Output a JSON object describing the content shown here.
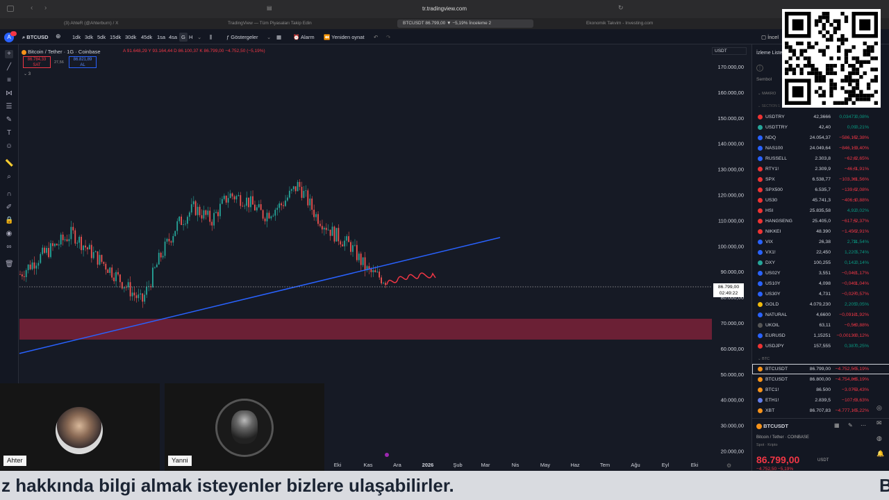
{
  "browser": {
    "url": "tr.tradingview.com"
  },
  "tabs": [
    {
      "label": "(3) AhteR (@Ahterburn) / X"
    },
    {
      "label": "TradingView — Tüm Piyasaları Takip Edin"
    },
    {
      "label": "BTCUSDT 86.799,00 ▼ −5,19% İnceleme 2"
    },
    {
      "label": "Ekonomik Takvim - Investing.com"
    }
  ],
  "toolbar": {
    "symbol": "BTCUSD",
    "intervals": [
      "1dk",
      "3dk",
      "5dk",
      "15dk",
      "30dk",
      "45dk",
      "1sa",
      "4sa",
      "G",
      "H"
    ],
    "indicators": "Göstergeler",
    "alarm": "Alarm",
    "replay": "Yeniden oynat",
    "right_label": "İncel"
  },
  "chart": {
    "title": "Bitcoin / Tether · 1G · Coinbase",
    "ohlc": "A 91.648,29  Y 93.164,44  D 86.100,37  K 86.799,00 −4.752,50 (−5,19%)",
    "sell_price": "86.784,33",
    "sell_label": "SAT",
    "spread": "27,56",
    "buy_price": "86.821,89",
    "buy_label": "AL",
    "indicator_count": "3",
    "currency": "USDT",
    "price_label": "86.799,00",
    "countdown": "02:49:22",
    "y_ticks": [
      "170.000,00",
      "160.000,00",
      "150.000,00",
      "140.000,00",
      "130.000,00",
      "120.000,00",
      "110.000,00",
      "100.000,00",
      "90.000,00",
      "80.000,00",
      "70.000,00",
      "60.000,00",
      "50.000,00",
      "40.000,00",
      "30.000,00",
      "20.000,00"
    ],
    "x_ticks": [
      "Eki",
      "Kas",
      "Ara",
      "2026",
      "Şub",
      "Mar",
      "Nis",
      "May",
      "Haz",
      "Tem",
      "Ağu",
      "Eyl",
      "Eki"
    ]
  },
  "chart_data": {
    "type": "candlestick",
    "title": "Bitcoin / Tether · 1G · Coinbase",
    "y_range": [
      20000,
      170000
    ],
    "x_labels": [
      "Eki",
      "Kas",
      "Ara",
      "2026",
      "Şub",
      "Mar",
      "Nis",
      "May",
      "Haz",
      "Tem",
      "Ağu",
      "Eyl",
      "Eki"
    ],
    "last_close": 86799.0,
    "support_zone": [
      66000,
      75000
    ],
    "trendline": "ascending blue support line",
    "price_path": [
      89000,
      95000,
      100000,
      105000,
      98000,
      92000,
      85000,
      78000,
      95000,
      108000,
      115000,
      110000,
      120000,
      118000,
      112000,
      116000,
      124000,
      112000,
      105000,
      100000,
      90000,
      86799
    ]
  },
  "watchlist": {
    "title": "İzleme Listesi",
    "col_header": "Sembol",
    "group_makro": "MAKRO",
    "section": "SECTION 1",
    "rows": [
      {
        "s": "USDTRY",
        "l": "42,3666",
        "c": "0,03473",
        "p": "0,08%",
        "color": "#e33",
        "pos": true
      },
      {
        "s": "USDTTRY",
        "l": "42,40",
        "c": "0,09",
        "p": "0,21%",
        "color": "#26a69a",
        "pos": true
      },
      {
        "s": "NDQ",
        "l": "24.054,37",
        "c": "−586,15",
        "p": "−2,38%",
        "color": "#2962ff",
        "pos": false
      },
      {
        "s": "NAS100",
        "l": "24.049,64",
        "c": "−846,13",
        "p": "−3,40%",
        "color": "#2962ff",
        "pos": false
      },
      {
        "s": "RUSSELL",
        "l": "2.303,8",
        "c": "−62,8",
        "p": "−2,65%",
        "color": "#2962ff",
        "pos": false
      },
      {
        "s": "RTY1!",
        "l": "2.309,9",
        "c": "−46,0",
        "p": "−1,91%",
        "color": "#e33",
        "pos": false
      },
      {
        "s": "SPX",
        "l": "6.538,77",
        "c": "−103,38",
        "p": "−1,56%",
        "color": "#e33",
        "pos": false
      },
      {
        "s": "SPX500",
        "l": "6.535,7",
        "c": "−139,0",
        "p": "−2,08%",
        "color": "#e33",
        "pos": false
      },
      {
        "s": "US30",
        "l": "45.741,3",
        "c": "−406,1",
        "p": "−0,88%",
        "color": "#e33",
        "pos": false
      },
      {
        "s": "HSI",
        "l": "25.835,58",
        "c": "4,92",
        "p": "0,02%",
        "color": "#e33",
        "pos": true
      },
      {
        "s": "HANGSENG",
        "l": "25.405,0",
        "c": "−617,5",
        "p": "−2,37%",
        "color": "#e33",
        "pos": false
      },
      {
        "s": "NIKKEI",
        "l": "48.390",
        "c": "−1.450",
        "p": "−2,91%",
        "color": "#e33",
        "pos": false
      },
      {
        "s": "VIX",
        "l": "26,38",
        "c": "2,73",
        "p": "11,54%",
        "color": "#2962ff",
        "pos": true
      },
      {
        "s": "VX1!",
        "l": "22,450",
        "c": "1,220",
        "p": "5,74%",
        "color": "#2962ff",
        "pos": true
      },
      {
        "s": "DXY",
        "l": "100,255",
        "c": "0,142",
        "p": "0,14%",
        "color": "#26a69a",
        "pos": true
      },
      {
        "s": "US02Y",
        "l": "3,551",
        "c": "−0,042",
        "p": "−1,17%",
        "color": "#2962ff",
        "pos": false
      },
      {
        "s": "US10Y",
        "l": "4,098",
        "c": "−0,043",
        "p": "−1,04%",
        "color": "#2962ff",
        "pos": false
      },
      {
        "s": "US30Y",
        "l": "4,731",
        "c": "−0,027",
        "p": "−0,57%",
        "color": "#2962ff",
        "pos": false
      },
      {
        "s": "GOLD",
        "l": "4.079,230",
        "c": "2,205",
        "p": "0,05%",
        "color": "#f0b90b",
        "pos": true
      },
      {
        "s": "NATURAL",
        "l": "4,6600",
        "c": "−0,0912",
        "p": "−1,92%",
        "color": "#2962ff",
        "pos": false
      },
      {
        "s": "UKOIL",
        "l": "63,11",
        "c": "−0,56",
        "p": "−0,88%",
        "color": "#555",
        "pos": false
      },
      {
        "s": "EURUSD",
        "l": "1,15251",
        "c": "−0,00133",
        "p": "−0,12%",
        "color": "#2962ff",
        "pos": false
      },
      {
        "s": "USDJPY",
        "l": "157,555",
        "c": "0,387",
        "p": "0,25%",
        "color": "#e33",
        "pos": true
      }
    ],
    "group_btc": "BTC",
    "btc_rows": [
      {
        "s": "BTCUSDT",
        "l": "86.799,00",
        "c": "−4.752,50",
        "p": "−5,19%",
        "color": "#f7931a",
        "pos": false
      },
      {
        "s": "BTCUSDT",
        "l": "86.800,00",
        "c": "−4.754,86",
        "p": "−5,19%",
        "color": "#f7931a",
        "pos": false
      },
      {
        "s": "BTC1!",
        "l": "86.500",
        "c": "−3.075",
        "p": "−3,43%",
        "color": "#f7931a",
        "pos": false
      },
      {
        "s": "ETH1!",
        "l": "2.839,5",
        "c": "−107,0",
        "p": "−3,63%",
        "color": "#627eea",
        "pos": false
      },
      {
        "s": "XBT",
        "l": "86.707,83",
        "c": "−4.777,10",
        "p": "−5,22%",
        "color": "#f7931a",
        "pos": false
      }
    ]
  },
  "details": {
    "symbol": "BTCUSDT",
    "name": "Bitcoin / Tether",
    "exchange": "COINBASE",
    "type": "Spot · Kripto",
    "price": "86.799,00",
    "currency": "USDT",
    "change": "−4.752,50  −5,19%"
  },
  "cams": {
    "left_name": "Ahter",
    "right_name": "Yanni"
  },
  "caption": {
    "text": "z hakkında bilgi almak isteyenler bizlere ulaşabilirler.",
    "right": "B"
  }
}
